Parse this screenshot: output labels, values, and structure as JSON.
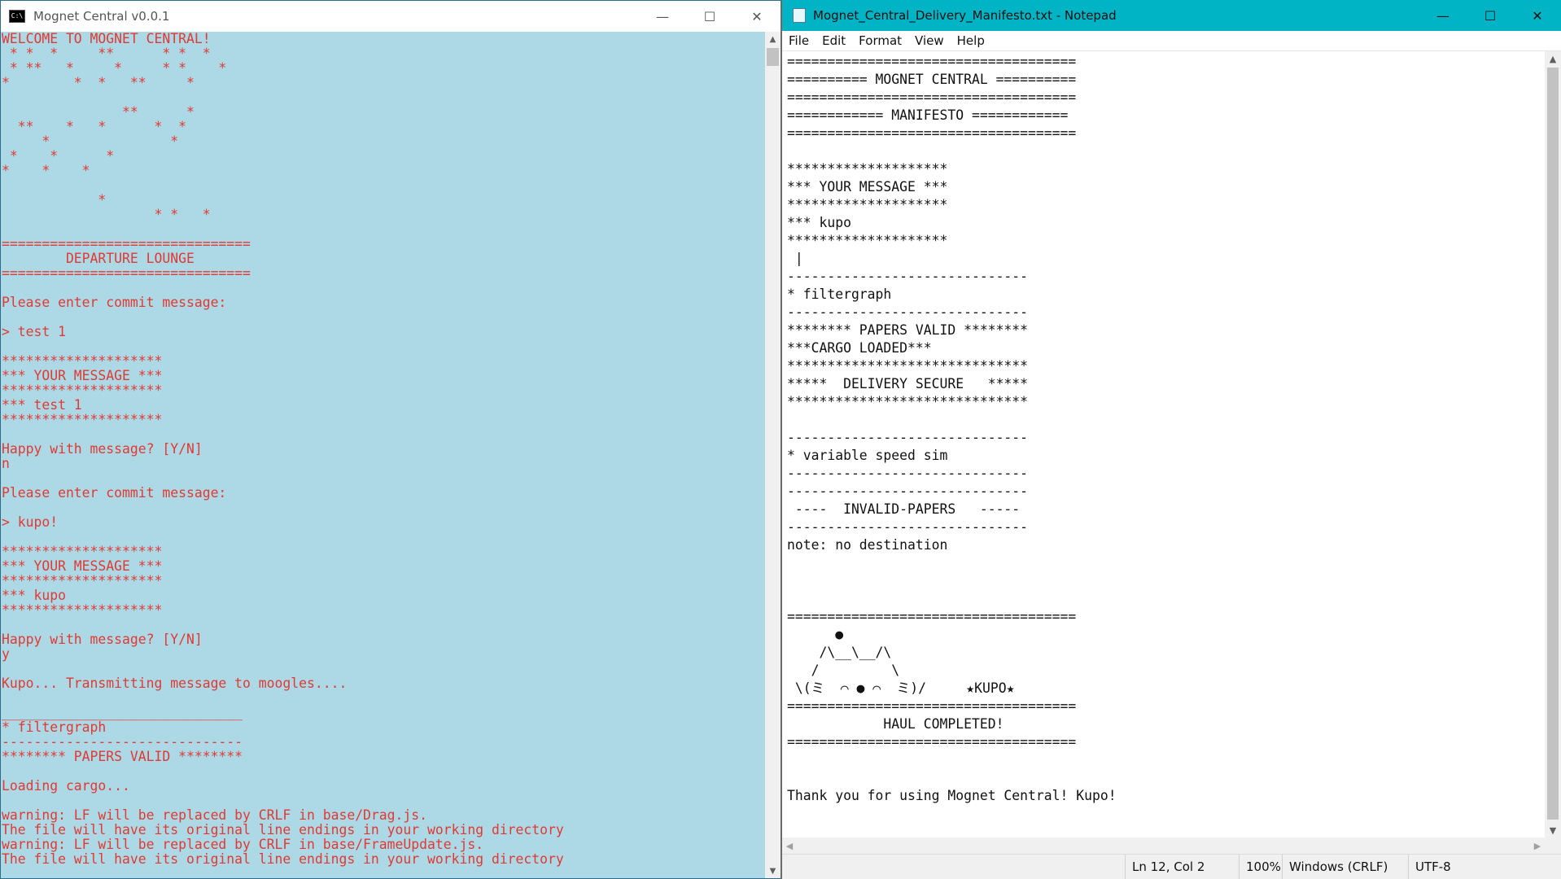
{
  "console": {
    "title": "Mognet Central v0.0.1",
    "icon": "console-icon",
    "buttons": {
      "minimize": "—",
      "maximize": "☐",
      "close": "✕"
    },
    "text": "WELCOME TO MOGNET CENTRAL!\n * *  *     **      * *  *\n * **   *     *     * *    *\n*        *  *   **     *\n\n               **      *\n  **    *   *      *  *\n     *               *\n *    *      *\n*    *    *\n\n            *\n                   * *   *\n\n===============================\n        DEPARTURE LOUNGE\n===============================\n\nPlease enter commit message:\n\n> test 1\n\n********************\n*** YOUR MESSAGE ***\n********************\n*** test 1\n********************\n\nHappy with message? [Y/N]\nn\n\nPlease enter commit message:\n\n> kupo!\n\n********************\n*** YOUR MESSAGE ***\n********************\n*** kupo\n********************\n\nHappy with message? [Y/N]\ny\n\nKupo... Transmitting message to moogles....\n\n______________________________\n* filtergraph\n------------------------------\n******** PAPERS VALID ********\n\nLoading cargo...\n\nwarning: LF will be replaced by CRLF in base/Drag.js.\nThe file will have its original line endings in your working directory\nwarning: LF will be replaced by CRLF in base/FrameUpdate.js.\nThe file will have its original line endings in your working directory"
  },
  "notepad": {
    "title": "Mognet_Central_Delivery_Manifesto.txt - Notepad",
    "icon": "notepad-icon",
    "buttons": {
      "minimize": "—",
      "maximize": "☐",
      "close": "✕"
    },
    "menu": [
      "File",
      "Edit",
      "Format",
      "View",
      "Help"
    ],
    "text": "====================================\n========== MOGNET CENTRAL ==========\n====================================\n============ MANIFESTO ============\n====================================\n\n********************\n*** YOUR MESSAGE ***\n********************\n*** kupo\n********************\n |\n------------------------------\n* filtergraph\n------------------------------\n******** PAPERS VALID ********\n***CARGO LOADED***\n******************************\n*****  DELIVERY SECURE   *****\n******************************\n\n------------------------------\n* variable speed sim\n------------------------------\n------------------------------\n ----  INVALID-PAPERS   -----\n------------------------------\nnote: no destination\n\n\n\n====================================\n      ●\n    /\\__\\__/\\\n   /         \\\n \\(ミ  ⌒ ● ⌒  ミ)/     ★KUPO★\n====================================\n            HAUL COMPLETED!\n====================================\n\n\nThank you for using Mognet Central! Kupo!",
    "status": {
      "position": "Ln 12, Col 2",
      "zoom": "100%",
      "line_endings": "Windows (CRLF)",
      "encoding": "UTF-8"
    }
  }
}
